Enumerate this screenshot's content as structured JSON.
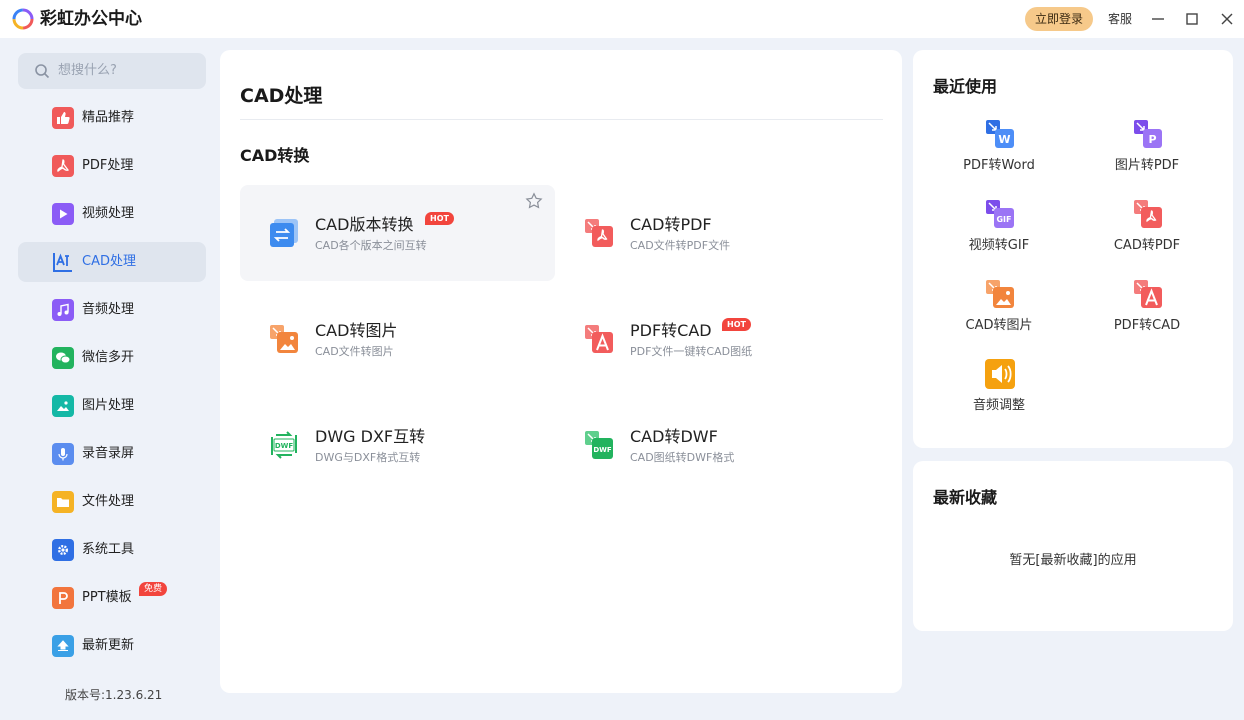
{
  "app": {
    "title": "彩虹办公中心",
    "login": "立即登录",
    "service": "客服"
  },
  "sidebar": {
    "search_placeholder": "想搜什么?",
    "items": [
      {
        "label": "精品推荐",
        "icon": "thumbs-up-icon",
        "color": "#f05a5a"
      },
      {
        "label": "PDF处理",
        "icon": "pdf-icon",
        "color": "#f05a5a"
      },
      {
        "label": "视频处理",
        "icon": "play-icon",
        "color": "#8b5cf6"
      },
      {
        "label": "CAD处理",
        "icon": "cad-icon",
        "color": "#3b82f6",
        "active": true
      },
      {
        "label": "音频处理",
        "icon": "music-icon",
        "color": "#8b5cf6"
      },
      {
        "label": "微信多开",
        "icon": "wechat-icon",
        "color": "#22b35e"
      },
      {
        "label": "图片处理",
        "icon": "image-icon",
        "color": "#14b8a6"
      },
      {
        "label": "录音录屏",
        "icon": "mic-icon",
        "color": "#5b8def"
      },
      {
        "label": "文件处理",
        "icon": "folder-icon",
        "color": "#f5b325"
      },
      {
        "label": "系统工具",
        "icon": "gear-icon",
        "color": "#2f6fe4"
      },
      {
        "label": "PPT模板",
        "icon": "ppt-icon",
        "color": "#f2753d",
        "badge": "免费"
      },
      {
        "label": "最新更新",
        "icon": "upload-icon",
        "color": "#3aa0e6"
      }
    ],
    "version": "版本号:1.23.6.21"
  },
  "main": {
    "title": "CAD处理",
    "section": "CAD转换",
    "cards": [
      {
        "title": "CAD版本转换",
        "desc": "CAD各个版本之间互转",
        "badge": "HOT",
        "icon": "swap-icon"
      },
      {
        "title": "CAD转PDF",
        "desc": "CAD文件转PDF文件",
        "icon": "cad-to-pdf-icon"
      },
      {
        "title": "CAD转图片",
        "desc": "CAD文件转图片",
        "icon": "cad-to-image-icon"
      },
      {
        "title": "PDF转CAD",
        "desc": "PDF文件一键转CAD图纸",
        "badge": "HOT",
        "icon": "pdf-to-cad-icon"
      },
      {
        "title": "DWG DXF互转",
        "desc": "DWG与DXF格式互转",
        "icon": "dwf-convert-icon"
      },
      {
        "title": "CAD转DWF",
        "desc": "CAD图纸转DWF格式",
        "icon": "cad-to-dwf-icon"
      }
    ]
  },
  "recent": {
    "title": "最近使用",
    "items": [
      {
        "label": "PDF转Word",
        "icon": "pdf-to-word-icon"
      },
      {
        "label": "图片转PDF",
        "icon": "image-to-pdf-icon"
      },
      {
        "label": "视频转GIF",
        "icon": "video-to-gif-icon"
      },
      {
        "label": "CAD转PDF",
        "icon": "cad-to-pdf-icon"
      },
      {
        "label": "CAD转图片",
        "icon": "cad-to-image-icon"
      },
      {
        "label": "PDF转CAD",
        "icon": "pdf-to-cad-icon"
      },
      {
        "label": "音频调整",
        "icon": "audio-adjust-icon"
      }
    ]
  },
  "favorites": {
    "title": "最新收藏",
    "empty": "暂无[最新收藏]的应用"
  }
}
